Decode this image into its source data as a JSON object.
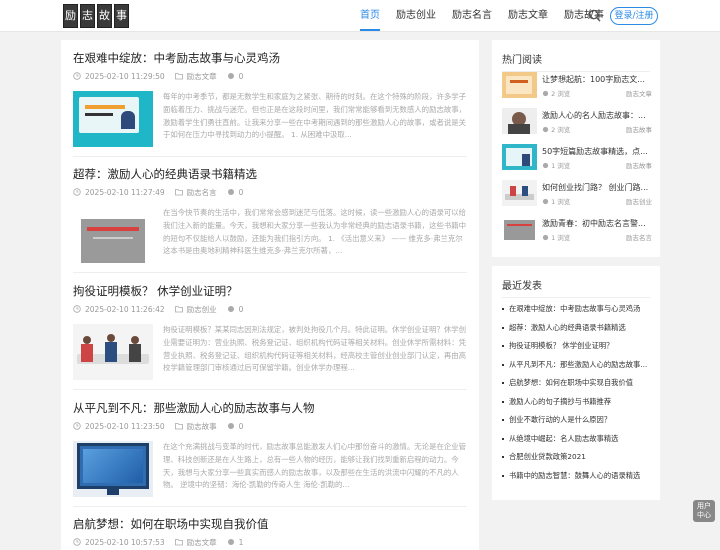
{
  "logo": {
    "chars": [
      "励",
      "志",
      "故",
      "事"
    ]
  },
  "nav": {
    "items": [
      {
        "label": "首页",
        "active": true
      },
      {
        "label": "励志创业"
      },
      {
        "label": "励志名言"
      },
      {
        "label": "励志文章"
      },
      {
        "label": "励志故事"
      }
    ],
    "login": "登录/注册"
  },
  "articles": [
    {
      "title": "在艰难中绽放：中考励志故事与心灵鸡汤",
      "date": "2025-02-10 11:29:50",
      "category": "励志文章",
      "comments": "0",
      "excerpt": "每年的中考季节，都是无数学生和家庭为之紧张、期待的时刻。在这个特殊的阶段，许多学子面临着压力、挑战与迷茫。但也正是在这段时间里，我们常常能够看到无数感人的励志故事，激励着学生们勇往直前。让我来分享一些在中考期间遇到的那些激励人心的故事，或者说是关于如何在压力中寻找到动力的小提醒。 1. 从困难中汲取..."
    },
    {
      "title": "超荐：激励人心的经典语录书籍精选",
      "date": "2025-02-10 11:27:49",
      "category": "励志名言",
      "comments": "0",
      "excerpt": "在当今快节奏的生活中，我们常常会感到迷茫与低落。这时候，读一些激励人心的语录可以给我们注入新的能量。今天，我想和大家分享一些我认为非常经典的励志语录书籍，这些书籍中的短句不仅能给人以鼓励，还能为我们指引方向。 1. 《活出意义来》 —— 维克多·弗兰克尔 这本书是由奥地利精神科医生维克多·弗兰克尔所著，..."
    },
    {
      "title": "拘役证明模板？ 休学创业证明？",
      "date": "2025-02-10 11:26:42",
      "category": "励志创业",
      "comments": "0",
      "excerpt": "拘役证明模板？某某同志因刑法规定，被判处拘役几个月。特此证明。休学创业证明？休学创业需要证明为：营业执照、税务登记证、组织机构代码证等相关材料。创业休学所需材料：凭营业执照、税务登记证、组织机构代码证等相关材料，经高校主管创业创业部门认定，再由高校学籍管理部门审核通过后可保留学籍。创业休学办理程..."
    },
    {
      "title": "从平凡到不凡：那些激励人心的励志故事与人物",
      "date": "2025-02-10 11:23:50",
      "category": "励志故事",
      "comments": "0",
      "excerpt": "在这个充满挑战与变革的时代，励志故事总能激发人们心中那份奋斗的激情。无论是在企业管理、科技创新还是在人生路上，总有一些人物的经历，能够让我们找到重新启程的动力。今天，我想与大家分享一些真实而感人的励志故事，以及那些在生活的洪流中闪耀的不凡的人物。 逆境中的坚韧：海伦·凯勒的传奇人生 海伦·凯勒的..."
    },
    {
      "title": "启航梦想：如何在职场中实现自我价值",
      "date": "2025-02-10 10:57:53",
      "category": "励志文章",
      "comments": "1"
    }
  ],
  "hot": {
    "title": "热门阅读",
    "items": [
      {
        "title": "让梦想起航：100字励志文...",
        "views": "2 浏览",
        "category": "励志文章"
      },
      {
        "title": "激励人心的名人励志故事：...",
        "views": "2 浏览",
        "category": "励志故事"
      },
      {
        "title": "50字短篇励志故事精选，点...",
        "views": "1 浏览",
        "category": "励志故事"
      },
      {
        "title": "如何创业找门路？ 创业门路...",
        "views": "1 浏览",
        "category": "励志创业"
      },
      {
        "title": "激励青春：初中励志名言警...",
        "views": "1 浏览",
        "category": "励志名言"
      }
    ]
  },
  "recent": {
    "title": "最近发表",
    "items": [
      "在艰难中绽放：中考励志故事与心灵鸡汤",
      "超荐：激励人心的经典语录书籍精选",
      "拘役证明模板？ 休学创业证明？",
      "从平凡到不凡：那些激励人心的励志故事...",
      "启航梦想：如何在职场中实现自我价值",
      "激励人心的句子摘抄与书籍推荐",
      "创业不敢行动的人是什么原因？",
      "从绝境中崛起：名人励志故事精选",
      "合肥创业贷款政策2021",
      "书籍中的励志智慧：鼓舞人心的语录精选"
    ]
  },
  "float": {
    "label": "用户 中心"
  },
  "colors": {
    "accent": "#2b8ae6"
  }
}
